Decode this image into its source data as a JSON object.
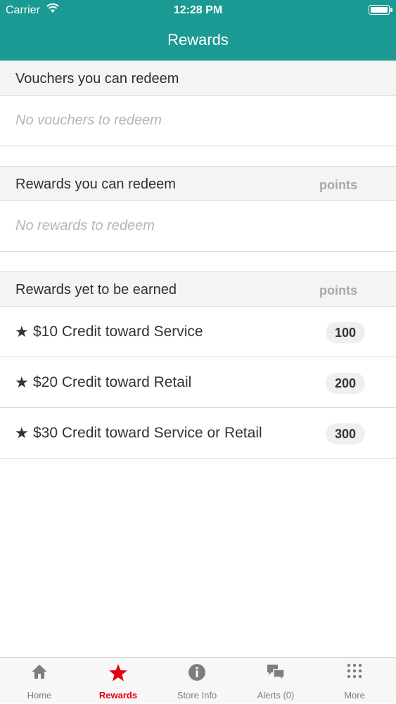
{
  "status_bar": {
    "carrier": "Carrier",
    "time": "12:28 PM"
  },
  "nav": {
    "title": "Rewards"
  },
  "vouchers": {
    "title": "Vouchers you can redeem",
    "empty": "No vouchers to redeem"
  },
  "redeemable": {
    "title": "Rewards you can redeem",
    "points_label": "points",
    "empty": "No rewards to redeem"
  },
  "to_earn": {
    "title": "Rewards yet to be earned",
    "points_label": "points",
    "star": "★",
    "items": [
      {
        "label": "$10 Credit toward Service",
        "points": "100"
      },
      {
        "label": "$20 Credit toward Retail",
        "points": "200"
      },
      {
        "label": "$30 Credit toward Service or Retail",
        "points": "300"
      }
    ]
  },
  "tabs": [
    {
      "label": "Home",
      "icon": "home-icon"
    },
    {
      "label": "Rewards",
      "icon": "star-icon",
      "active": true
    },
    {
      "label": "Store Info",
      "icon": "info-icon"
    },
    {
      "label": "Alerts (0)",
      "icon": "chat-bubbles-icon"
    },
    {
      "label": "More",
      "icon": "grid-dots-icon"
    }
  ],
  "colors": {
    "nav_bg": "#1b9a93",
    "active_tab": "#e3000f",
    "inactive_tab": "#7d7d7d"
  }
}
